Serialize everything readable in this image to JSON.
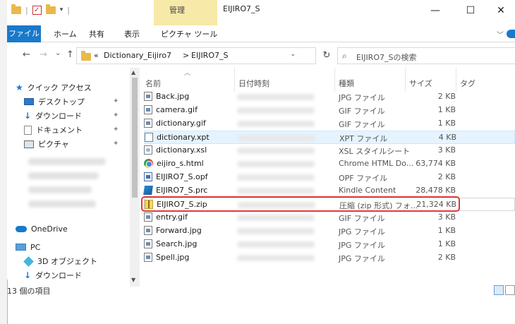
{
  "titlebar": {
    "title": "EIJIRO7_S",
    "manage_tab": "管理",
    "qat_separator": "|",
    "qat_dropdown": "▾",
    "minimize": "—",
    "maximize": "☐",
    "close": "✕"
  },
  "ribbon": {
    "tabs": [
      "ファイル",
      "ホーム",
      "共有",
      "表示",
      "ピクチャ ツール"
    ],
    "collapse": "﹀"
  },
  "nav": {
    "back": "←",
    "forward": "→",
    "recent": "⌄",
    "up": "↑",
    "crumb_overflow": "«",
    "crumbs": [
      "Dictionary_Eijiro7",
      "EIJIRO7_S"
    ],
    "crumb_separator": ">",
    "address_dropdown": "⌄",
    "refresh": "↻",
    "search_placeholder": "EIJIRO7_Sの検索"
  },
  "navpane": {
    "quick_access": "クイック アクセス",
    "pinned": [
      {
        "label": "デスクトップ",
        "icon": "desktop-icon"
      },
      {
        "label": "ダウンロード",
        "icon": "download-icon"
      },
      {
        "label": "ドキュメント",
        "icon": "documents-icon"
      },
      {
        "label": "ピクチャ",
        "icon": "pictures-icon"
      }
    ],
    "onedrive": "OneDrive",
    "pc": "PC",
    "pc_items": [
      "3D オブジェクト",
      "ダウンロード"
    ],
    "pin_glyph": "📌"
  },
  "columns": {
    "name": "名前",
    "date": "日付時刻",
    "type": "種類",
    "size": "サイズ",
    "tag": "タグ"
  },
  "files": [
    {
      "name": "Back.jpg",
      "type": "JPG ファイル",
      "size": "2 KB",
      "icon": "image-file-icon"
    },
    {
      "name": "camera.gif",
      "type": "GIF ファイル",
      "size": "1 KB",
      "icon": "image-file-icon"
    },
    {
      "name": "dictionary.gif",
      "type": "GIF ファイル",
      "size": "1 KB",
      "icon": "image-file-icon"
    },
    {
      "name": "dictionary.xpt",
      "type": "XPT ファイル",
      "size": "4 KB",
      "icon": "blank-file-icon"
    },
    {
      "name": "dictionary.xsl",
      "type": "XSL スタイルシート",
      "size": "3 KB",
      "icon": "xsl-file-icon"
    },
    {
      "name": "eijiro_s.html",
      "type": "Chrome HTML Do...",
      "size": "63,774 KB",
      "icon": "chrome-html-icon"
    },
    {
      "name": "EIJIRO7_S.opf",
      "type": "OPF ファイル",
      "size": "2 KB",
      "icon": "opf-file-icon"
    },
    {
      "name": "EIJIRO7_S.prc",
      "type": "Kindle Content",
      "size": "28,478 KB",
      "icon": "kindle-file-icon"
    },
    {
      "name": "EIJIRO7_S.zip",
      "type": "圧縮 (zip 形式) フォ...",
      "size": "21,324 KB",
      "icon": "zip-folder-icon"
    },
    {
      "name": "entry.gif",
      "type": "GIF ファイル",
      "size": "3 KB",
      "icon": "image-file-icon"
    },
    {
      "name": "Forward.jpg",
      "type": "JPG ファイル",
      "size": "1 KB",
      "icon": "image-file-icon"
    },
    {
      "name": "Search.jpg",
      "type": "JPG ファイル",
      "size": "1 KB",
      "icon": "image-file-icon"
    },
    {
      "name": "Spell.jpg",
      "type": "JPG ファイル",
      "size": "2 KB",
      "icon": "image-file-icon"
    }
  ],
  "status": {
    "item_count": "13 個の項目"
  },
  "colors": {
    "accent": "#1979ca",
    "highlight_ring": "#e0393c",
    "selected_row": "#e5f3ff",
    "manage_tab": "#f7e9a8"
  }
}
